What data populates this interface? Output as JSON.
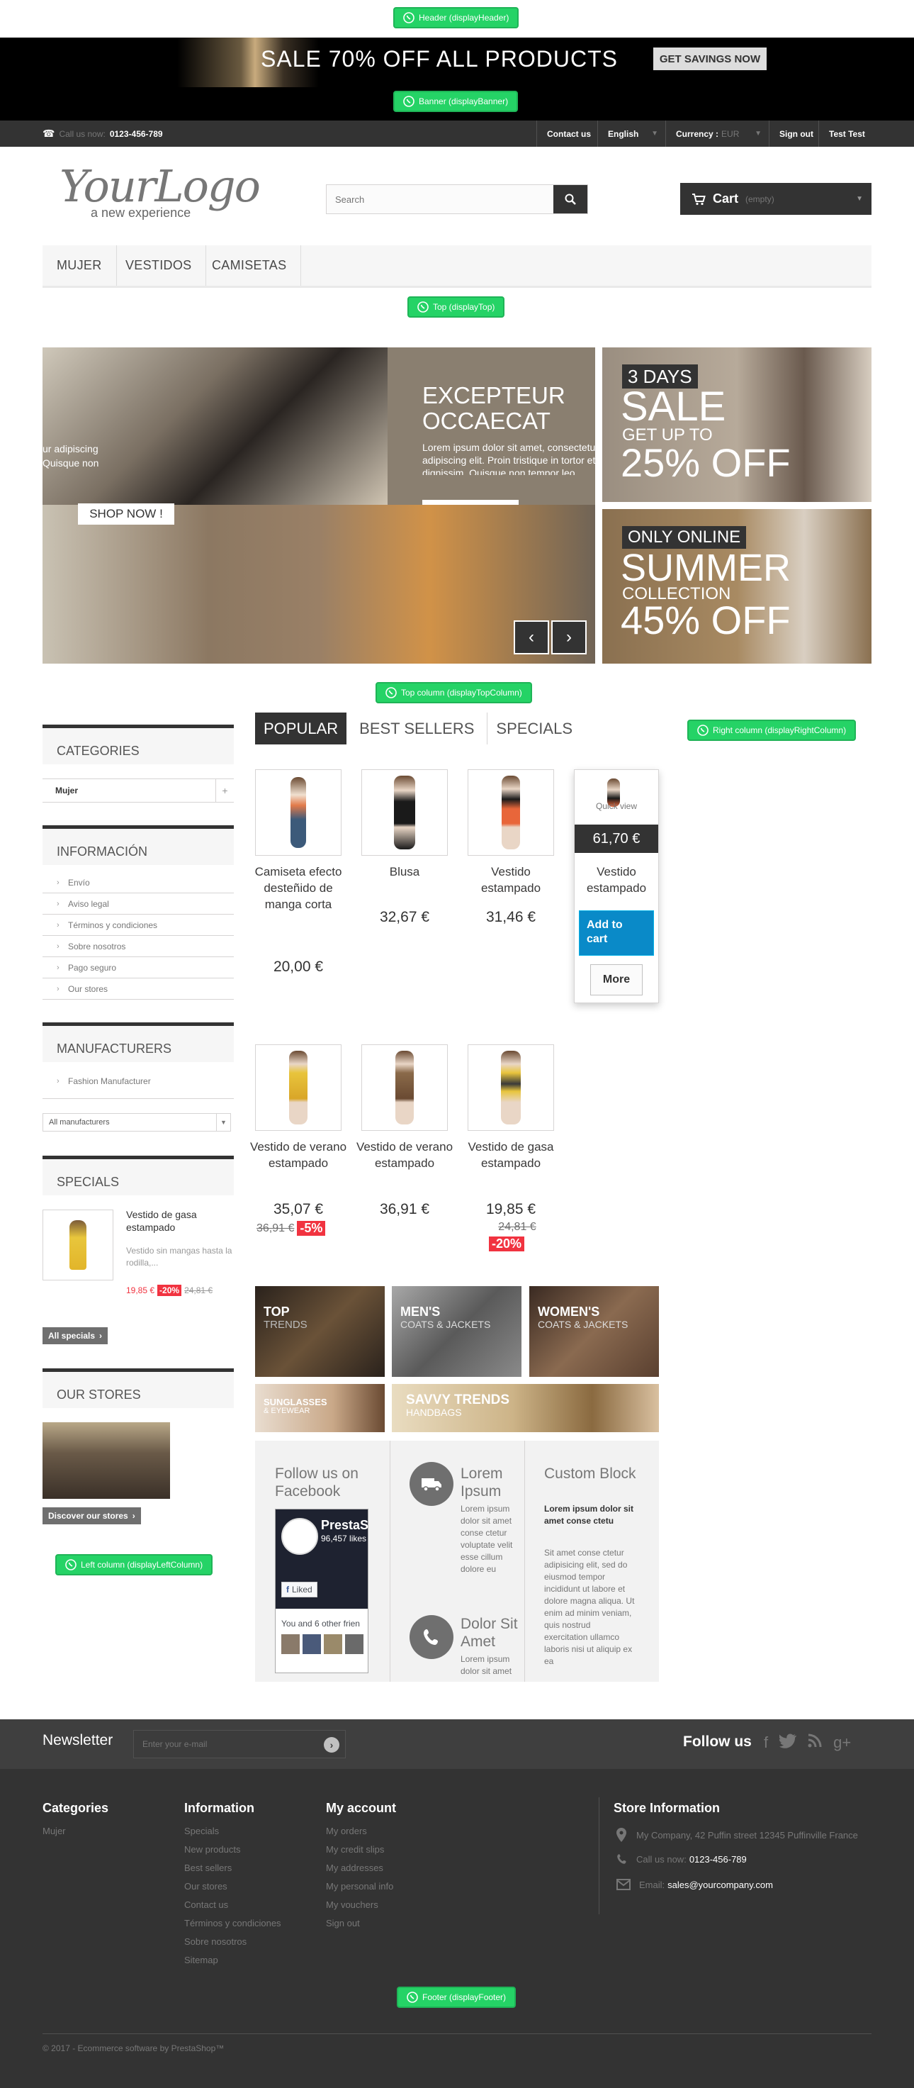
{
  "hooks": {
    "header": "Header (displayHeader)",
    "banner": "Banner (displayBanner)",
    "top": "Top (displayTop)",
    "top_column": "Top column (displayTopColumn)",
    "right_column": "Right column (displayRightColumn)",
    "left_column": "Left column (displayLeftColumn)",
    "footer": "Footer (displayFooter)"
  },
  "banner": {
    "headline": "SALE 70% OFF ALL PRODUCTS",
    "cta": "GET SAVINGS NOW"
  },
  "topbar": {
    "call_label": "Call us now:",
    "phone": "0123-456-789",
    "contact": "Contact us",
    "language": "English",
    "currency_label": "Currency :",
    "currency_value": "EUR",
    "signout": "Sign out",
    "user": "Test Test"
  },
  "logo": {
    "main": "YourLogo",
    "tagline": "a new experience"
  },
  "search": {
    "placeholder": "Search"
  },
  "cart": {
    "label": "Cart",
    "status": "(empty)"
  },
  "menu": [
    "MUJER",
    "VESTIDOS",
    "CAMISETAS"
  ],
  "slider": {
    "title_line1": "EXCEPTEUR",
    "title_line2": "OCCAECAT",
    "body": "Lorem ipsum dolor sit amet, consectetur adipiscing elit. Proin tristique in tortor et dignissim. Quisque non tempor leo. Maecenas egestas sem elit",
    "left_text_1": "ur adipiscing",
    "left_text_2": "Quisque non",
    "shop_now": "SHOP NOW !"
  },
  "promo1": {
    "days": "3 DAYS",
    "sale": "SALE",
    "getupto": "GET UP TO",
    "off": "25% OFF"
  },
  "promo2": {
    "online": "ONLY ONLINE",
    "summer": "SUMMER",
    "collection": "COLLECTION",
    "off": "45% OFF"
  },
  "tabs": [
    "POPULAR",
    "BEST SELLERS",
    "SPECIALS"
  ],
  "products_row1": [
    {
      "name": "Camiseta efecto desteñido de manga corta",
      "price": "20,00 €"
    },
    {
      "name": "Blusa",
      "price": "32,67 €"
    },
    {
      "name": "Vestido estampado",
      "price": "31,46 €"
    },
    {
      "name": "Vestido estampado",
      "price": "61,70 €",
      "quick_view": "Quick view",
      "add": "Add to cart",
      "more": "More"
    }
  ],
  "products_row2": [
    {
      "name": "Vestido de verano estampado",
      "price": "35,07 €",
      "old": "36,91 €",
      "discount": "-5%"
    },
    {
      "name": "Vestido de verano estampado",
      "price": "36,91 €"
    },
    {
      "name": "Vestido de gasa estampado",
      "price": "19,85 €",
      "old": "24,81 €",
      "discount": "-20%"
    }
  ],
  "categories": {
    "title": "CATEGORIES",
    "items": [
      "Mujer"
    ]
  },
  "informacion": {
    "title": "INFORMACIÓN",
    "items": [
      "Envío",
      "Aviso legal",
      "Términos y condiciones",
      "Sobre nosotros",
      "Pago seguro",
      "Our stores"
    ]
  },
  "manufacturers": {
    "title": "MANUFACTURERS",
    "items": [
      "Fashion Manufacturer"
    ],
    "select": "All manufacturers"
  },
  "specials": {
    "title": "SPECIALS",
    "name": "Vestido de gasa estampado",
    "desc": "Vestido sin mangas hasta la rodilla,...",
    "price": "19,85 €",
    "discount": "-20%",
    "old": "24,81 €",
    "all": "All specials"
  },
  "stores": {
    "title": "OUR STORES",
    "button": "Discover our stores"
  },
  "banners": {
    "top": "TOP",
    "trends": "TRENDS",
    "mens": "MEN'S",
    "mens_sub": "COATS & JACKETS",
    "womens": "WOMEN'S",
    "womens_sub": "COATS & JACKETS",
    "sunglasses": "SUNGLASSES",
    "eyewear": "& EYEWEAR",
    "savvy": "SAVVY TRENDS",
    "handbags": "HANDBAGS"
  },
  "cms": {
    "fb_title": "Follow us on Facebook",
    "fb_page": "PrestaS",
    "fb_likes": "96,457 likes",
    "fb_liked": "Liked",
    "fb_friends": "You and 6 other frien",
    "lorem_title": "Lorem Ipsum",
    "lorem_body": "Lorem ipsum dolor sit amet conse ctetur voluptate velit esse cillum dolore eu",
    "dolor_title": "Dolor Sit Amet",
    "dolor_body": "Lorem ipsum dolor sit amet",
    "custom_title": "Custom Block",
    "custom_bold": "Lorem ipsum dolor sit amet conse ctetu",
    "custom_body": "Sit amet conse ctetur adipisicing elit, sed do eiusmod tempor incididunt ut labore et dolore magna aliqua. Ut enim ad minim veniam, quis nostrud exercitation ullamco laboris nisi ut aliquip ex ea"
  },
  "newsletter": {
    "title": "Newsletter",
    "placeholder": "Enter your e-mail",
    "follow": "Follow us"
  },
  "footer": {
    "categories_title": "Categories",
    "categories": [
      "Mujer"
    ],
    "info_title": "Information",
    "info": [
      "Specials",
      "New products",
      "Best sellers",
      "Our stores",
      "Contact us",
      "Términos y condiciones",
      "Sobre nosotros",
      "Sitemap"
    ],
    "account_title": "My account",
    "account": [
      "My orders",
      "My credit slips",
      "My addresses",
      "My personal info",
      "My vouchers",
      "Sign out"
    ],
    "store_title": "Store Information",
    "address": "My Company, 42 Puffin street 12345 Puffinville France",
    "call": "Call us now:",
    "phone": "0123-456-789",
    "email_label": "Email:",
    "email": "sales@yourcompany.com",
    "copyright": "© 2017 - Ecommerce software by PrestaShop™"
  }
}
